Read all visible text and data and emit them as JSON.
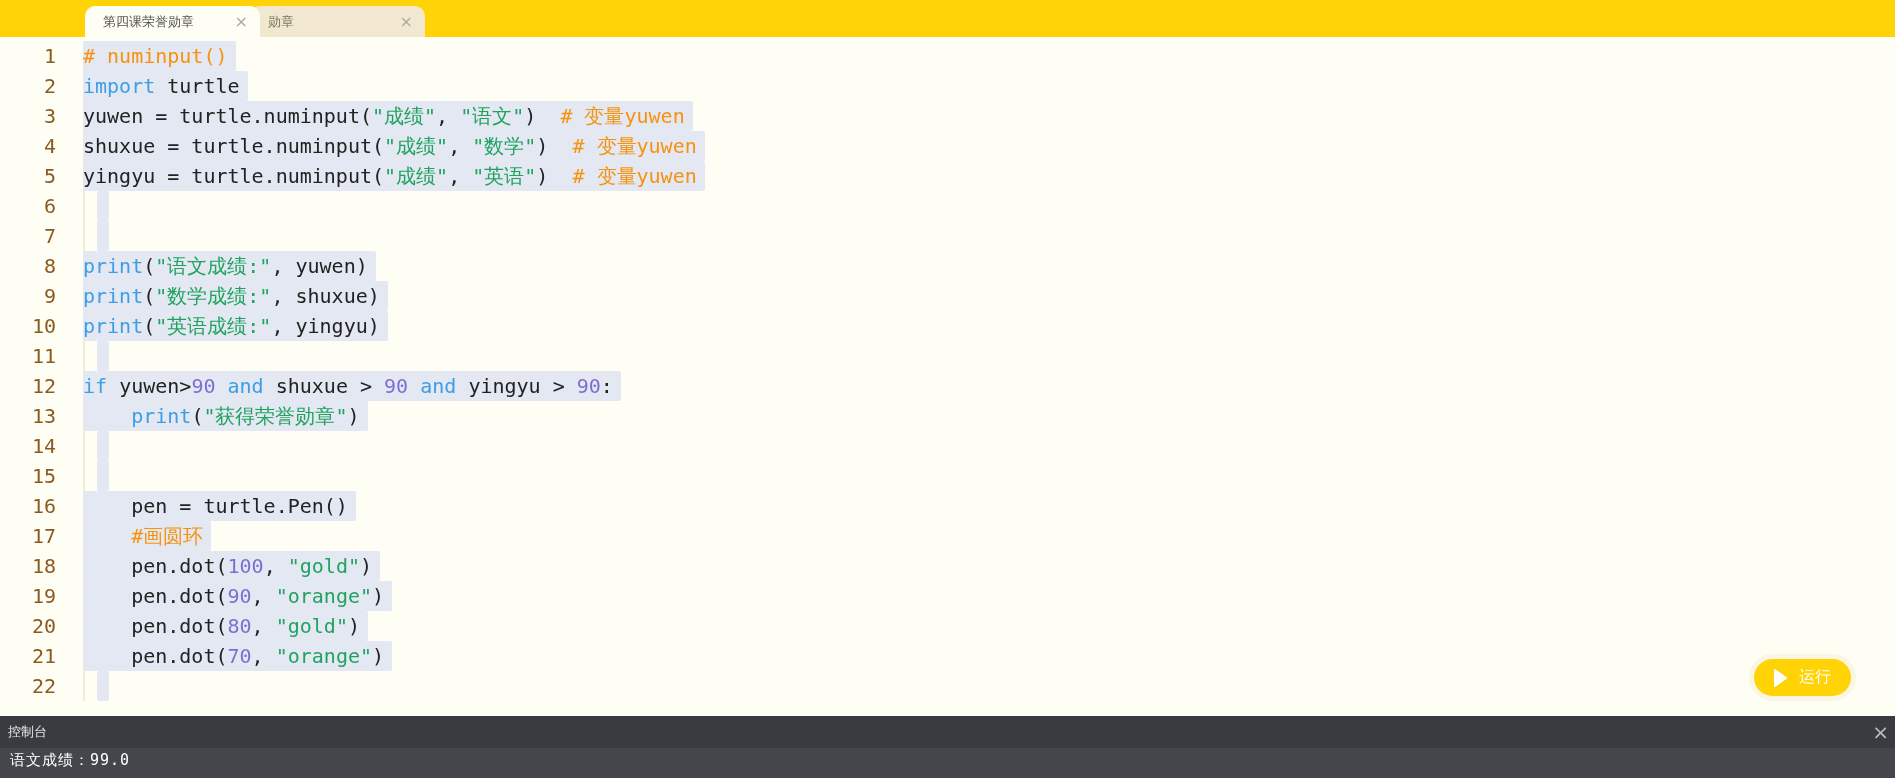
{
  "tabs": [
    {
      "label": "第四课荣誉勋章",
      "close": "×",
      "selected": true
    },
    {
      "label": "勋章",
      "close": "×",
      "selected": false
    }
  ],
  "editor": {
    "lines": [
      {
        "number": "1",
        "selected": true,
        "tokens": [
          {
            "kind": "comment",
            "text": "# numinput()"
          }
        ]
      },
      {
        "number": "2",
        "selected": true,
        "tokens": [
          {
            "kind": "keyword",
            "text": "import"
          },
          {
            "kind": "plain",
            "text": " turtle"
          }
        ]
      },
      {
        "number": "3",
        "selected": true,
        "tokens": [
          {
            "kind": "plain",
            "text": "yuwen = turtle.numinput("
          },
          {
            "kind": "string",
            "text": "\"成绩\""
          },
          {
            "kind": "plain",
            "text": ", "
          },
          {
            "kind": "string",
            "text": "\"语文\""
          },
          {
            "kind": "plain",
            "text": ")  "
          },
          {
            "kind": "comment",
            "text": "# 变量yuwen"
          }
        ]
      },
      {
        "number": "4",
        "selected": true,
        "tokens": [
          {
            "kind": "plain",
            "text": "shuxue = turtle.numinput("
          },
          {
            "kind": "string",
            "text": "\"成绩\""
          },
          {
            "kind": "plain",
            "text": ", "
          },
          {
            "kind": "string",
            "text": "\"数学\""
          },
          {
            "kind": "plain",
            "text": ")  "
          },
          {
            "kind": "comment",
            "text": "# 变量yuwen"
          }
        ]
      },
      {
        "number": "5",
        "selected": true,
        "tokens": [
          {
            "kind": "plain",
            "text": "yingyu = turtle.numinput("
          },
          {
            "kind": "string",
            "text": "\"成绩\""
          },
          {
            "kind": "plain",
            "text": ", "
          },
          {
            "kind": "string",
            "text": "\"英语\""
          },
          {
            "kind": "plain",
            "text": ")  "
          },
          {
            "kind": "comment",
            "text": "# 变量yuwen"
          }
        ]
      },
      {
        "number": "6",
        "selected": true
      },
      {
        "number": "7",
        "selected": true
      },
      {
        "number": "8",
        "selected": true,
        "tokens": [
          {
            "kind": "keyword",
            "text": "print"
          },
          {
            "kind": "plain",
            "text": "("
          },
          {
            "kind": "string",
            "text": "\"语文成绩:\""
          },
          {
            "kind": "plain",
            "text": ", yuwen)"
          }
        ]
      },
      {
        "number": "9",
        "selected": true,
        "tokens": [
          {
            "kind": "keyword",
            "text": "print"
          },
          {
            "kind": "plain",
            "text": "("
          },
          {
            "kind": "string",
            "text": "\"数学成绩:\""
          },
          {
            "kind": "plain",
            "text": ", shuxue)"
          }
        ]
      },
      {
        "number": "10",
        "selected": true,
        "tokens": [
          {
            "kind": "keyword",
            "text": "print"
          },
          {
            "kind": "plain",
            "text": "("
          },
          {
            "kind": "string",
            "text": "\"英语成绩:\""
          },
          {
            "kind": "plain",
            "text": ", yingyu)"
          }
        ]
      },
      {
        "number": "11",
        "selected": true
      },
      {
        "number": "12",
        "selected": true,
        "tokens": [
          {
            "kind": "keyword",
            "text": "if"
          },
          {
            "kind": "plain",
            "text": " yuwen>"
          },
          {
            "kind": "number",
            "text": "90"
          },
          {
            "kind": "keyword",
            "text": " and"
          },
          {
            "kind": "plain",
            "text": " shuxue > "
          },
          {
            "kind": "number",
            "text": "90"
          },
          {
            "kind": "keyword",
            "text": " and"
          },
          {
            "kind": "plain",
            "text": " yingyu > "
          },
          {
            "kind": "number",
            "text": "90"
          },
          {
            "kind": "plain",
            "text": ":"
          }
        ]
      },
      {
        "number": "13",
        "selected": true,
        "tokens": [
          {
            "kind": "keyword",
            "text": "    print"
          },
          {
            "kind": "plain",
            "text": "("
          },
          {
            "kind": "string",
            "text": "\"获得荣誉勋章\""
          },
          {
            "kind": "plain",
            "text": ")"
          }
        ]
      },
      {
        "number": "14",
        "selected": true
      },
      {
        "number": "15",
        "selected": true
      },
      {
        "number": "16",
        "selected": true,
        "tokens": [
          {
            "kind": "plain",
            "text": "    pen = turtle.Pen()"
          }
        ]
      },
      {
        "number": "17",
        "selected": true,
        "tokens": [
          {
            "kind": "comment",
            "text": "    #画圆环"
          }
        ]
      },
      {
        "number": "18",
        "selected": true,
        "tokens": [
          {
            "kind": "plain",
            "text": "    pen.dot("
          },
          {
            "kind": "number",
            "text": "100"
          },
          {
            "kind": "plain",
            "text": ", "
          },
          {
            "kind": "string",
            "text": "\"gold\""
          },
          {
            "kind": "plain",
            "text": ")"
          }
        ]
      },
      {
        "number": "19",
        "selected": true,
        "tokens": [
          {
            "kind": "plain",
            "text": "    pen.dot("
          },
          {
            "kind": "number",
            "text": "90"
          },
          {
            "kind": "plain",
            "text": ", "
          },
          {
            "kind": "string",
            "text": "\"orange\""
          },
          {
            "kind": "plain",
            "text": ")"
          }
        ]
      },
      {
        "number": "20",
        "selected": true,
        "tokens": [
          {
            "kind": "plain",
            "text": "    pen.dot("
          },
          {
            "kind": "number",
            "text": "80"
          },
          {
            "kind": "plain",
            "text": ", "
          },
          {
            "kind": "string",
            "text": "\"gold\""
          },
          {
            "kind": "plain",
            "text": ")"
          }
        ]
      },
      {
        "number": "21",
        "selected": true,
        "tokens": [
          {
            "kind": "plain",
            "text": "    pen.dot("
          },
          {
            "kind": "number",
            "text": "70"
          },
          {
            "kind": "plain",
            "text": ", "
          },
          {
            "kind": "string",
            "text": "\"orange\""
          },
          {
            "kind": "plain",
            "text": ")"
          }
        ]
      },
      {
        "number": "22",
        "selected": true
      }
    ]
  },
  "run_button": {
    "label": "运行"
  },
  "console": {
    "title": "控制台",
    "close": "×",
    "output": [
      "语文成绩：99.0"
    ]
  }
}
